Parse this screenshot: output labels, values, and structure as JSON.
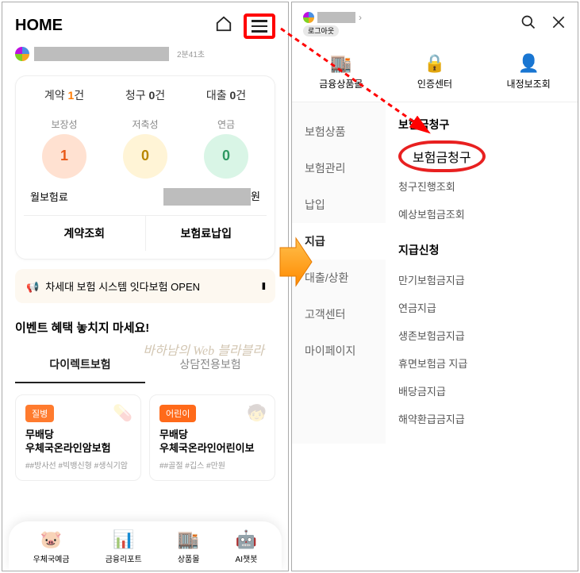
{
  "left": {
    "header_title": "HOME",
    "time_suffix": "2분41초",
    "stats": {
      "contracts_label": "계약",
      "contracts_n": "1",
      "contracts_unit": "건",
      "claims_label": "청구",
      "claims_n": "0",
      "claims_unit": "건",
      "loans_label": "대출",
      "loans_n": "0",
      "loans_unit": "건"
    },
    "circles": {
      "c1_label": "보장성",
      "c1_val": "1",
      "c2_label": "저축성",
      "c2_val": "0",
      "c3_label": "연금",
      "c3_val": "0"
    },
    "premium_label": "월보험료",
    "premium_unit": "원",
    "action1": "계약조회",
    "action2": "보험료납입",
    "banner_text": "차세대 보험 시스템 잇다보험 OPEN",
    "banner_pause": "II",
    "event_title": "이벤트 혜택 놓치지 마세요!",
    "watermark": "바하남의 Web 블라블라",
    "tab1": "다이렉트보험",
    "tab2": "상담전용보험",
    "products": [
      {
        "badge": "질병",
        "name_l1": "무배당",
        "name_l2": "우체국온라인암보험",
        "tags": "##방사선 #빅뱅신형 #생식기암"
      },
      {
        "badge": "어린이",
        "name_l1": "무배당",
        "name_l2": "우체국온라인어린이보",
        "tags": "##골절 #깁스 #만원"
      }
    ],
    "nav": [
      "우체국예금",
      "금융리포트",
      "상품몰",
      "AI챗봇"
    ]
  },
  "right": {
    "logout": "로그아웃",
    "top_menu": [
      "금융상품몰",
      "인증센터",
      "내정보조회"
    ],
    "left_menu": [
      "보험상품",
      "보험관리",
      "납입",
      "지급",
      "대출/상환",
      "고객센터",
      "마이페이지"
    ],
    "left_menu_active_index": 3,
    "section1_title": "보험금청구",
    "section1_items": [
      "보험금청구",
      "청구진행조회",
      "예상보험금조회"
    ],
    "section2_title": "지급신청",
    "section2_items": [
      "만기보험금지급",
      "연금지급",
      "생존보험금지급",
      "휴면보험금 지급",
      "배당금지급",
      "해약환급금지급"
    ]
  }
}
